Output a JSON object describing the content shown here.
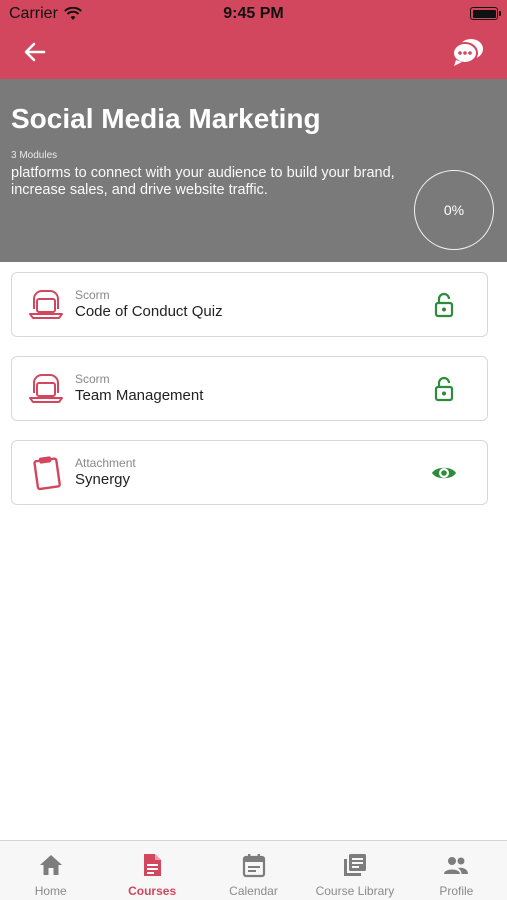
{
  "status_bar": {
    "carrier": "Carrier",
    "time": "9:45 PM"
  },
  "nav": {
    "back_icon": "arrow-left-icon",
    "chat_icon": "chat-bubbles-icon",
    "bar_color": "#d2475e"
  },
  "course": {
    "title": "Social Media Marketing",
    "modules_count": "3 Modules",
    "description": "platforms to connect with your audience to build your brand, increase sales, and drive website traffic.",
    "progress": "0%"
  },
  "modules": [
    {
      "type": "Scorm",
      "name": "Code of Conduct Quiz",
      "icon": "laptop-icon",
      "status_icon": "unlock-icon"
    },
    {
      "type": "Scorm",
      "name": "Team Management",
      "icon": "laptop-icon",
      "status_icon": "unlock-icon"
    },
    {
      "type": "Attachment",
      "name": "Synergy",
      "icon": "clipboard-icon",
      "status_icon": "eye-icon"
    }
  ],
  "tabs": [
    {
      "label": "Home",
      "icon": "home-icon",
      "active": false
    },
    {
      "label": "Courses",
      "icon": "document-icon",
      "active": true
    },
    {
      "label": "Calendar",
      "icon": "calendar-icon",
      "active": false
    },
    {
      "label": "Course Library",
      "icon": "library-icon",
      "active": false
    },
    {
      "label": "Profile",
      "icon": "people-icon",
      "active": false
    }
  ],
  "colors": {
    "accent": "#d2475e",
    "header_gray": "#7a7a7a",
    "status_green": "#2e8b3a"
  }
}
